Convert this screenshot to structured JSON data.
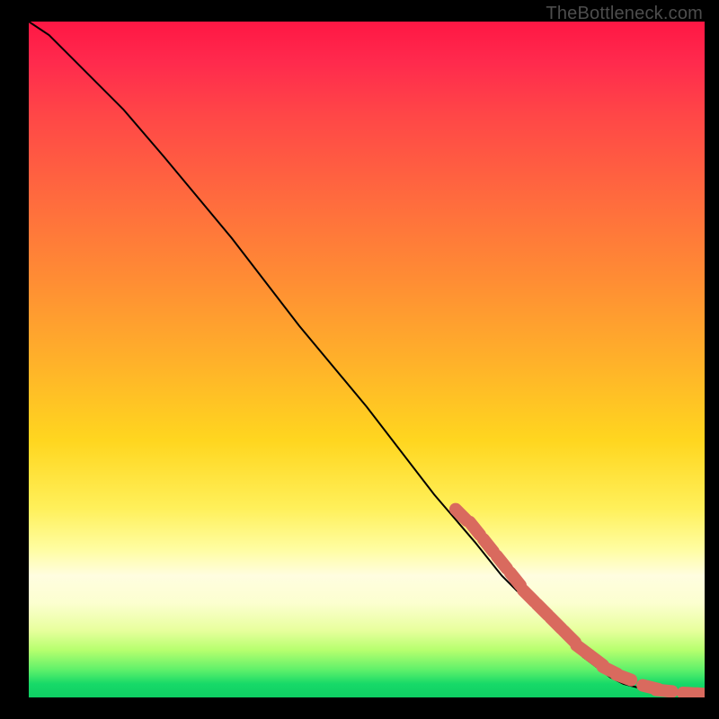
{
  "watermark": "TheBottleneck.com",
  "colors": {
    "background": "#000000",
    "curve": "#000000",
    "dot": "#d96a5e"
  },
  "chart_data": {
    "type": "line",
    "title": "",
    "xlabel": "",
    "ylabel": "",
    "xlim": [
      0,
      100
    ],
    "ylim": [
      0,
      100
    ],
    "series": [
      {
        "name": "bottleneck-curve",
        "x": [
          0,
          3,
          6,
          10,
          14,
          20,
          30,
          40,
          50,
          60,
          66,
          70,
          74,
          78,
          82,
          86,
          88,
          90,
          92,
          94,
          96,
          98,
          100
        ],
        "y": [
          100,
          98,
          95,
          91,
          87,
          80,
          68,
          55,
          43,
          30,
          23,
          18,
          14,
          10,
          6,
          3,
          2,
          1.5,
          1,
          0.8,
          0.6,
          0.5,
          0.5
        ]
      }
    ],
    "points": {
      "name": "highlighted-segment",
      "x": [
        64,
        66,
        68,
        70,
        72,
        74,
        76,
        78,
        80,
        82,
        84,
        86,
        88,
        92,
        94,
        98,
        100
      ],
      "y": [
        27,
        25,
        22.5,
        20,
        17.5,
        15,
        13,
        11,
        9,
        7,
        5.5,
        4,
        3,
        1.5,
        1,
        0.6,
        0.5
      ]
    }
  }
}
